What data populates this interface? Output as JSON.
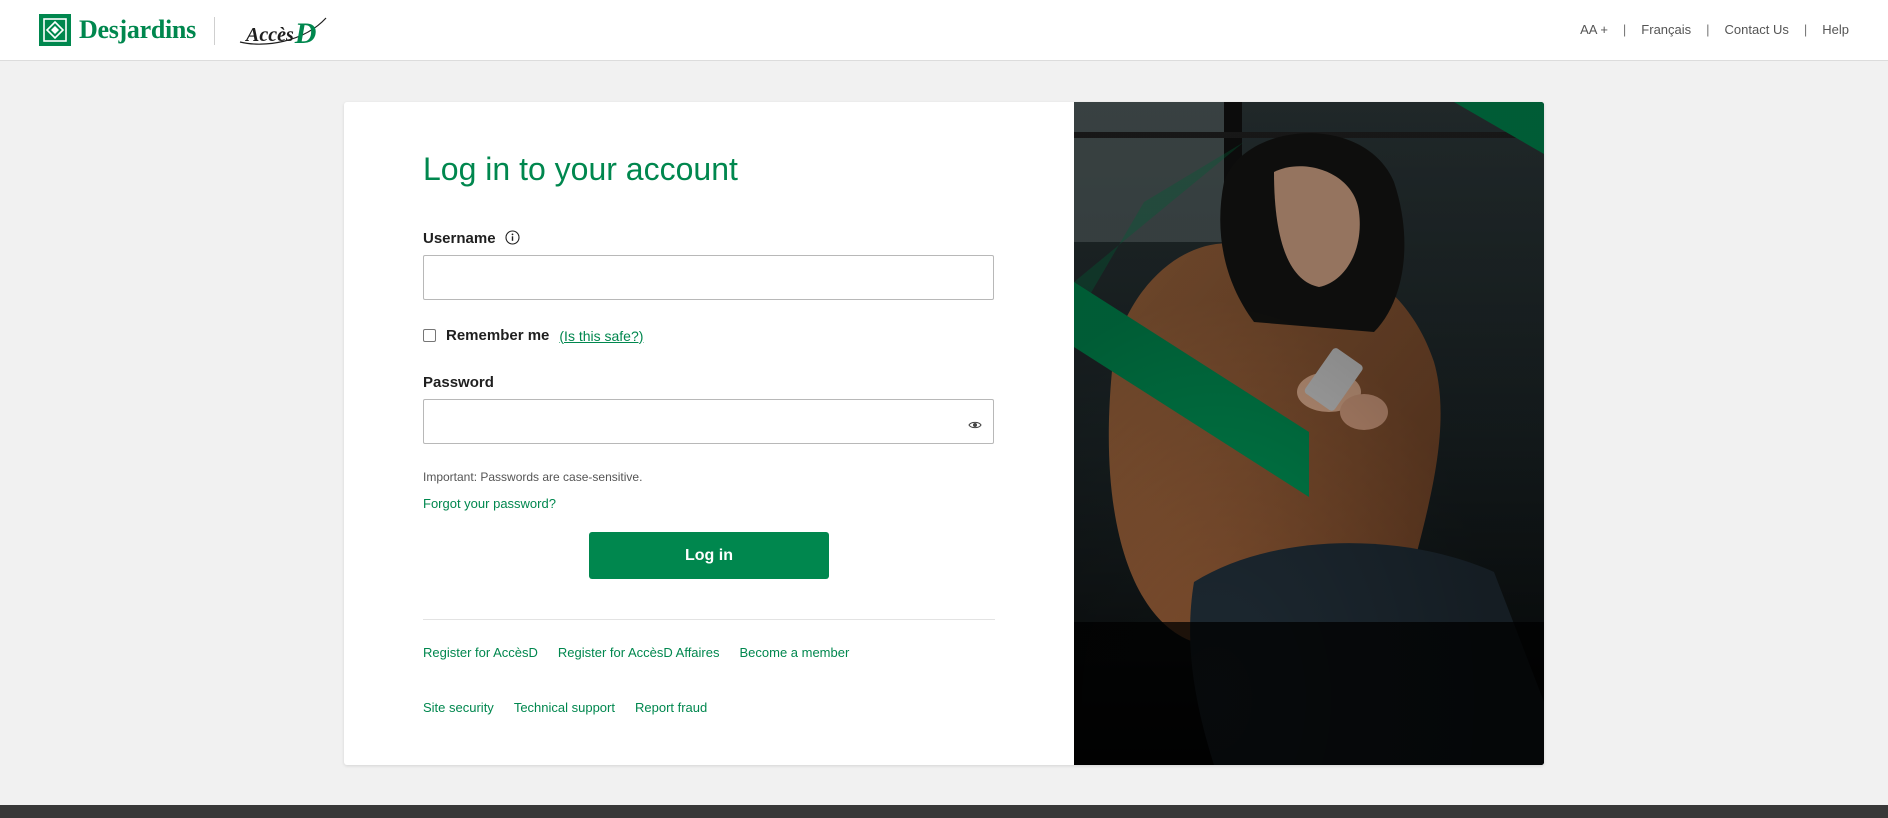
{
  "header": {
    "brand": "Desjardins",
    "product": "Accès",
    "product_d": "D",
    "nav": {
      "font_size": "AA +",
      "language": "Français",
      "contact": "Contact Us",
      "help": "Help",
      "separator": "|"
    }
  },
  "login": {
    "title": "Log in to your account",
    "username_label": "Username",
    "username_value": "",
    "remember_label": "Remember me",
    "remember_checked": false,
    "is_safe_link": "(Is this safe?)",
    "password_label": "Password",
    "password_value": "",
    "hint": "Important: Passwords are case-sensitive.",
    "forgot_link": "Forgot your password?",
    "login_button": "Log in"
  },
  "links_row1": [
    "Register for AccèsD",
    "Register for AccèsD Affaires",
    "Become a member"
  ],
  "links_row2": [
    "Site security",
    "Technical support",
    "Report fraud"
  ],
  "colors": {
    "brand_green": "#00874e",
    "background": "#f1f1f1",
    "footer": "#383838"
  },
  "icons": {
    "info": "info-icon",
    "eye": "eye-icon",
    "logo": "desjardins-logo-icon"
  }
}
